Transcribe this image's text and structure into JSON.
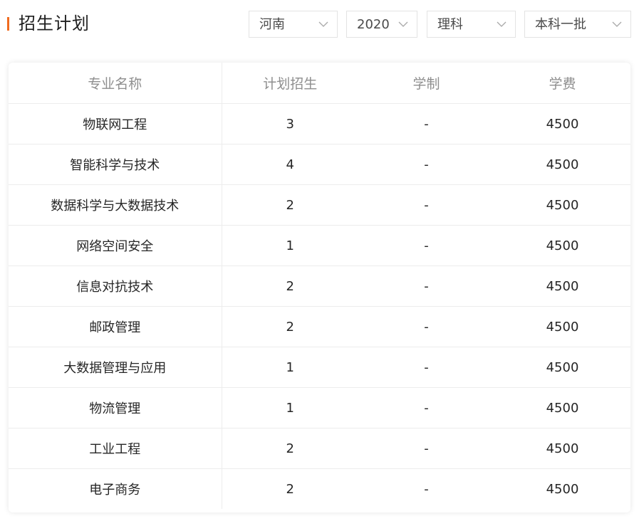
{
  "header": {
    "title": "招生计划",
    "accent_color": "#f06b1f",
    "filters": {
      "province": {
        "value": "河南",
        "icon": "chevron-down-icon"
      },
      "year": {
        "value": "2020",
        "icon": "chevron-down-icon"
      },
      "subject": {
        "value": "理科",
        "icon": "chevron-down-icon"
      },
      "batch": {
        "value": "本科一批",
        "icon": "chevron-down-icon"
      }
    }
  },
  "table": {
    "columns": [
      "专业名称",
      "计划招生",
      "学制",
      "学费"
    ],
    "rows": [
      [
        "物联网工程",
        "3",
        "-",
        "4500"
      ],
      [
        "智能科学与技术",
        "4",
        "-",
        "4500"
      ],
      [
        "数据科学与大数据技术",
        "2",
        "-",
        "4500"
      ],
      [
        "网络空间安全",
        "1",
        "-",
        "4500"
      ],
      [
        "信息对抗技术",
        "2",
        "-",
        "4500"
      ],
      [
        "邮政管理",
        "2",
        "-",
        "4500"
      ],
      [
        "大数据管理与应用",
        "1",
        "-",
        "4500"
      ],
      [
        "物流管理",
        "1",
        "-",
        "4500"
      ],
      [
        "工业工程",
        "2",
        "-",
        "4500"
      ],
      [
        "电子商务",
        "2",
        "-",
        "4500"
      ]
    ]
  }
}
